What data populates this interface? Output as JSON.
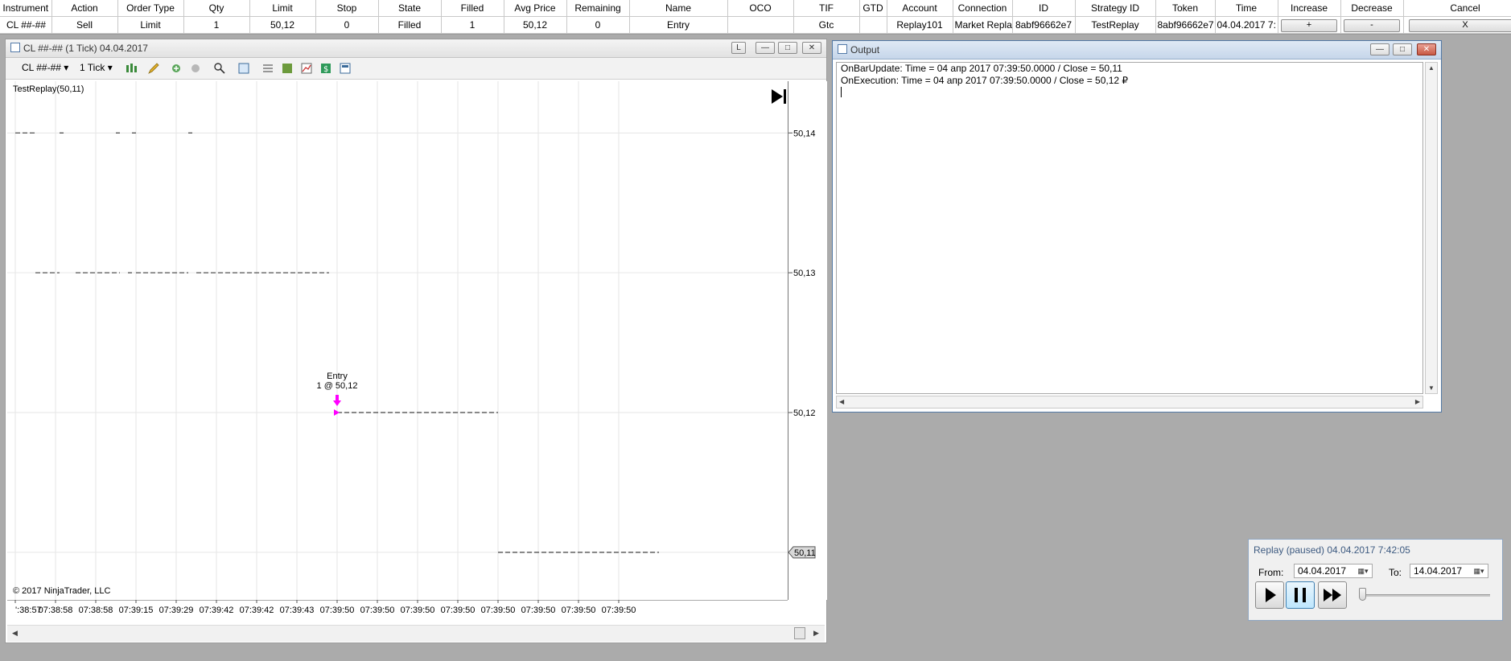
{
  "orders": {
    "columns": [
      "Instrument",
      "Action",
      "Order Type",
      "Qty",
      "Limit",
      "Stop",
      "State",
      "Filled",
      "Avg Price",
      "Remaining",
      "Name",
      "OCO",
      "TIF",
      "GTD",
      "Account",
      "Connection",
      "ID",
      "Strategy ID",
      "Token",
      "Time",
      "Increase",
      "Decrease",
      "Cancel"
    ],
    "row": {
      "instrument": "CL ##-##",
      "action": "Sell",
      "order_type": "Limit",
      "qty": "1",
      "limit": "50,12",
      "stop": "0",
      "state": "Filled",
      "filled": "1",
      "avg_price": "50,12",
      "remaining": "0",
      "name": "Entry",
      "oco": "",
      "tif": "Gtc",
      "gtd": "",
      "account": "Replay101",
      "connection": "Market Repla",
      "id": "8abf96662e7",
      "strategy_id": "TestReplay",
      "token": "8abf96662e7",
      "time": "04.04.2017 7:",
      "increase": "+",
      "decrease": "-",
      "cancel": "X"
    }
  },
  "chart_window": {
    "title": "CL ##-## (1 Tick)  04.04.2017",
    "link_label": "L",
    "toolbar": {
      "instrument": "CL ##-##",
      "interval": "1 Tick"
    },
    "strategy_label": "TestReplay(50,11)",
    "copyright": "© 2017 NinjaTrader, LLC"
  },
  "output_window": {
    "title": "Output",
    "lines": [
      "OnBarUpdate: Time = 04 апр 2017 07:39:50.0000 / Close = 50,11",
      "OnExecution: Time = 04 апр 2017 07:39:50.0000 / Close = 50,12 ₽"
    ]
  },
  "replay": {
    "title": "Replay (paused) 04.04.2017 7:42:05",
    "from_label": "From:",
    "from_value": "04.04.2017",
    "to_label": "To:",
    "to_value": "14.04.2017"
  },
  "colors": {
    "marker": "#ff00ff",
    "price_line": "#404040",
    "grid": "#e6e6e6"
  },
  "chart_data": {
    "type": "line",
    "x_tick_labels": [
      "':38:57",
      "07:38:58",
      "07:38:58",
      "07:39:15",
      "07:39:29",
      "07:39:42",
      "07:39:42",
      "07:39:43",
      "07:39:50",
      "07:39:50",
      "07:39:50",
      "07:39:50",
      "07:39:50",
      "07:39:50",
      "07:39:50",
      "07:39:50"
    ],
    "y_tick_labels": [
      "50,14",
      "50,13",
      "50,12"
    ],
    "y_ticks": [
      50.14,
      50.13,
      50.12,
      50.11
    ],
    "ylim": [
      50.1066,
      50.1437
    ],
    "last_price_label": "50,11",
    "last_price": 50.11,
    "series": [
      {
        "segments": [
          {
            "y": 50.14,
            "from": 0,
            "to": 0.5
          },
          {
            "y": 50.14,
            "from": 1.1,
            "to": 1.2
          },
          {
            "y": 50.14,
            "from": 2.5,
            "to": 2.6
          },
          {
            "y": 50.14,
            "from": 2.9,
            "to": 3.0
          },
          {
            "y": 50.14,
            "from": 4.3,
            "to": 4.4
          },
          {
            "y": 50.13,
            "from": 0.5,
            "to": 1.1
          },
          {
            "y": 50.13,
            "from": 1.5,
            "to": 2.6
          },
          {
            "y": 50.13,
            "from": 2.8,
            "to": 2.9
          },
          {
            "y": 50.13,
            "from": 3.0,
            "to": 4.3
          },
          {
            "y": 50.13,
            "from": 4.5,
            "to": 7.8
          },
          {
            "y": 50.12,
            "from": 8.0,
            "to": 12.0
          },
          {
            "y": 50.11,
            "from": 12.0,
            "to": 16.0
          }
        ]
      }
    ],
    "annotations": [
      {
        "text": "Entry",
        "line2": "1 @ 50,12",
        "x": 8.0,
        "y": 50.12,
        "marker": "sell-arrow"
      }
    ]
  }
}
